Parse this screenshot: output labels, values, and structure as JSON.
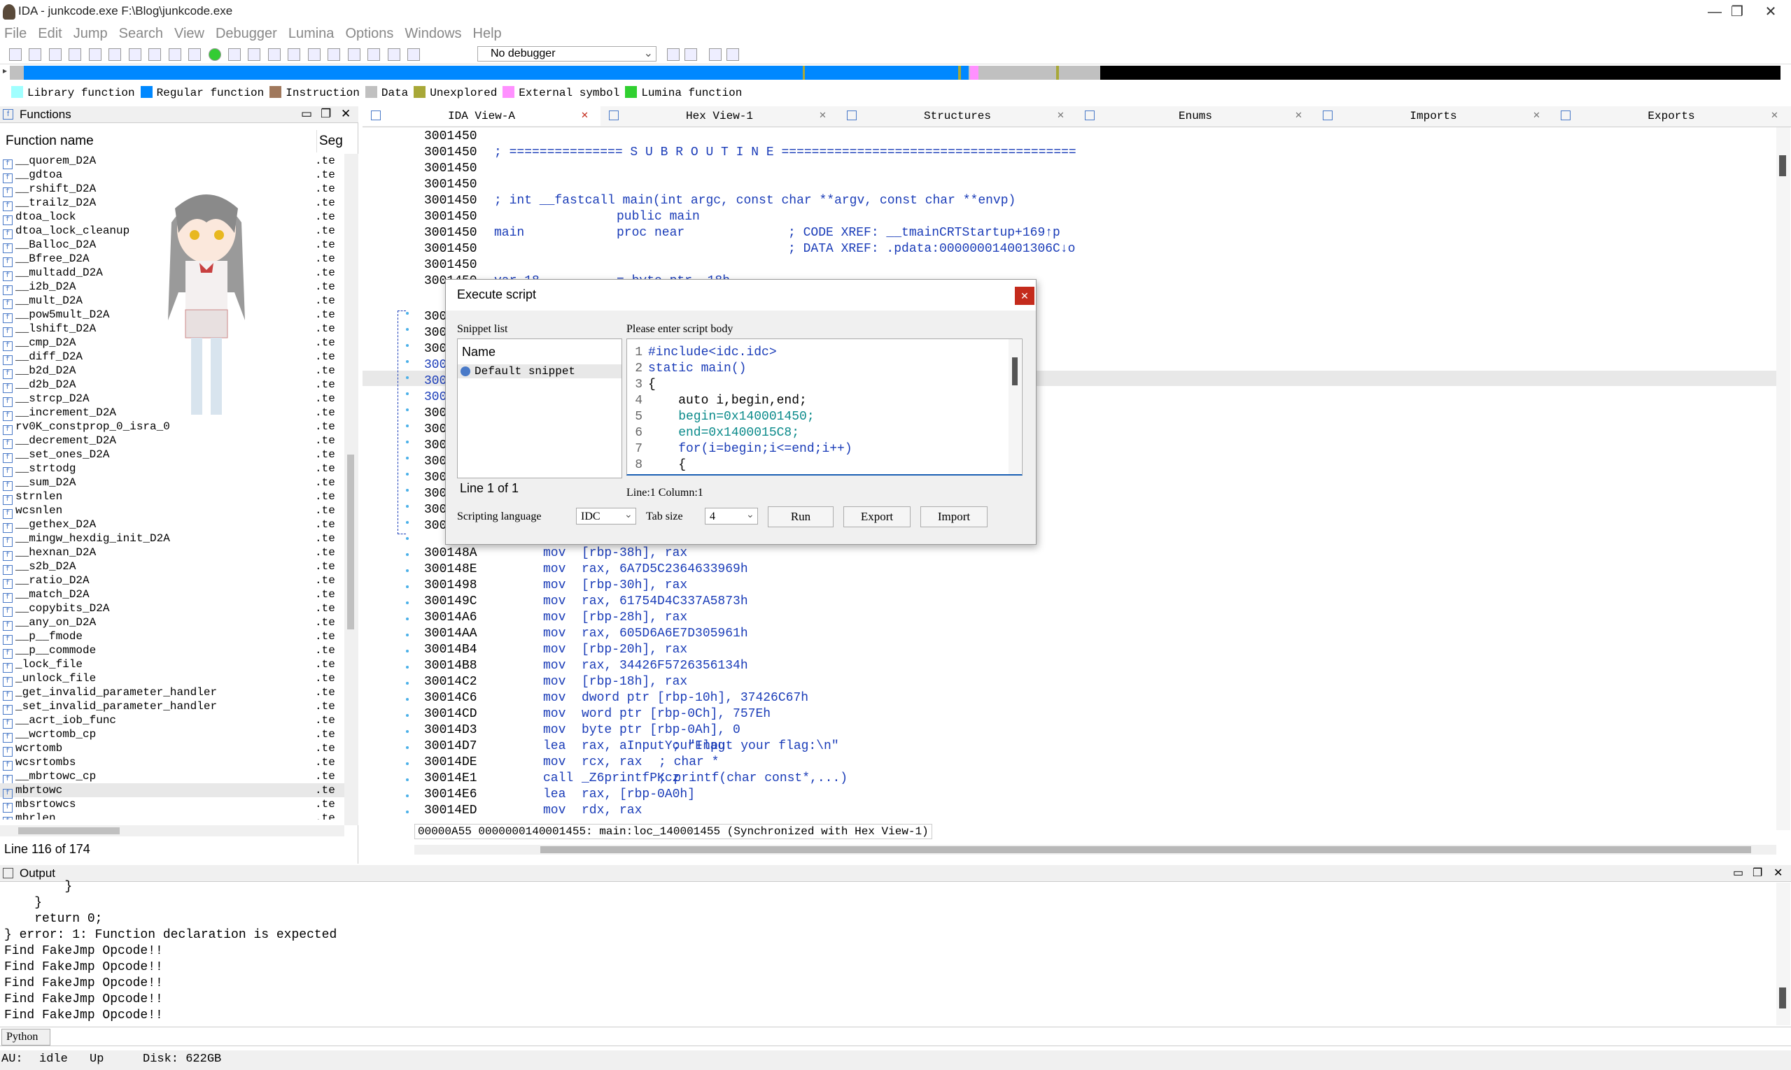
{
  "window": {
    "title": "IDA - junkcode.exe F:\\Blog\\junkcode.exe",
    "min": "—",
    "max": "❐",
    "close": "✕"
  },
  "menu": [
    "File",
    "Edit",
    "Jump",
    "Search",
    "View",
    "Debugger",
    "Lumina",
    "Options",
    "Windows",
    "Help"
  ],
  "toolbar": {
    "debugger": "No debugger"
  },
  "legend": [
    {
      "label": "Library function",
      "color": "#a0ffff"
    },
    {
      "label": "Regular function",
      "color": "#0088ff"
    },
    {
      "label": "Instruction",
      "color": "#a0785c"
    },
    {
      "label": "Data",
      "color": "#c0c0c0"
    },
    {
      "label": "Unexplored",
      "color": "#a8a838"
    },
    {
      "label": "External symbol",
      "color": "#ff90ff"
    },
    {
      "label": "Lumina function",
      "color": "#30d030"
    }
  ],
  "functions": {
    "title": "Functions",
    "col_name": "Function name",
    "col_seg": "Seg",
    "status": "Line 116 of 174",
    "items": [
      "__quorem_D2A",
      "__gdtoa",
      "__rshift_D2A",
      "__trailz_D2A",
      "dtoa_lock",
      "dtoa_lock_cleanup",
      "__Balloc_D2A",
      "__Bfree_D2A",
      "__multadd_D2A",
      "__i2b_D2A",
      "__mult_D2A",
      "__pow5mult_D2A",
      "__lshift_D2A",
      "__cmp_D2A",
      "__diff_D2A",
      "__b2d_D2A",
      "__d2b_D2A",
      "__strcp_D2A",
      "__increment_D2A",
      "rv0K_constprop_0_isra_0",
      "__decrement_D2A",
      "__set_ones_D2A",
      "__strtodg",
      "__sum_D2A",
      "strnlen",
      "wcsnlen",
      "__gethex_D2A",
      "__mingw_hexdig_init_D2A",
      "__hexnan_D2A",
      "__s2b_D2A",
      "__ratio_D2A",
      "__match_D2A",
      "__copybits_D2A",
      "__any_on_D2A",
      "__p__fmode",
      "__p__commode",
      "_lock_file",
      "_unlock_file",
      "_get_invalid_parameter_handler",
      "_set_invalid_parameter_handler",
      "__acrt_iob_func",
      "__wcrtomb_cp",
      "wcrtomb",
      "wcsrtombs",
      "__mbrtowc_cp",
      "mbrtowc",
      "mbsrtowcs",
      "mbrlen"
    ],
    "segs": [
      ".te",
      ".te",
      ".te",
      ".te",
      ".te",
      ".te",
      ".te",
      ".te",
      ".te",
      ".te",
      ".te",
      ".te",
      ".te",
      ".te",
      ".te",
      ".te",
      ".te",
      ".te",
      ".te",
      ".te",
      ".te",
      ".te",
      ".te",
      ".te",
      ".te",
      ".te",
      ".te",
      ".te",
      ".te",
      ".te",
      ".te",
      ".te",
      ".te",
      ".te",
      ".te",
      ".te",
      ".te",
      ".te",
      ".te",
      ".te",
      ".te",
      ".te",
      ".te",
      ".te",
      ".te",
      ".te",
      ".te",
      ".te"
    ]
  },
  "tabs": [
    "IDA View-A",
    "Hex View-1",
    "Structures",
    "Enums",
    "Imports",
    "Exports"
  ],
  "asm_top": [
    {
      "addr": "3001450",
      "c2": "",
      "mn": "",
      "op": "",
      "cm": ""
    },
    {
      "addr": "3001450",
      "c2": "; =============== S U B R O U T I N E =======================================",
      "mn": "",
      "op": "",
      "cm": ""
    },
    {
      "addr": "3001450",
      "c2": "",
      "mn": "",
      "op": "",
      "cm": ""
    },
    {
      "addr": "3001450",
      "c2": "",
      "mn": "",
      "op": "",
      "cm": ""
    },
    {
      "addr": "3001450",
      "c2": "; int __fastcall main(int argc, const char **argv, const char **envp)",
      "mn": "",
      "op": "",
      "cm": ""
    },
    {
      "addr": "3001450",
      "c2": "",
      "mn": "public main",
      "op": "",
      "cm": ""
    },
    {
      "addr": "3001450",
      "c2": "main",
      "mn": "proc near",
      "op": "",
      "cm": "; CODE XREF: __tmainCRTStartup+169↑p"
    },
    {
      "addr": "3001450",
      "c2": "",
      "mn": "",
      "op": "",
      "cm": "; DATA XREF: .pdata:000000014001306C↓o"
    },
    {
      "addr": "3001450",
      "c2": "",
      "mn": "",
      "op": "",
      "cm": ""
    },
    {
      "addr": "3001450",
      "c2": "var_18",
      "mn": "= byte ptr -18h",
      "op": "",
      "cm": ""
    }
  ],
  "asm_hidden": [
    "300",
    "300",
    "300",
    "300",
    "300",
    "300",
    "300",
    "300",
    "300",
    "300",
    "300",
    "300",
    "300",
    "300"
  ],
  "asm_bottom": [
    {
      "addr": "300148A",
      "mn": "mov",
      "op": "[rbp-38h], rax",
      "cm": ""
    },
    {
      "addr": "300148E",
      "mn": "mov",
      "op": "rax, 6A7D5C2364633969h",
      "cm": ""
    },
    {
      "addr": "3001498",
      "mn": "mov",
      "op": "[rbp-30h], rax",
      "cm": ""
    },
    {
      "addr": "300149C",
      "mn": "mov",
      "op": "rax, 61754D4C337A5873h",
      "cm": ""
    },
    {
      "addr": "30014A6",
      "mn": "mov",
      "op": "[rbp-28h], rax",
      "cm": ""
    },
    {
      "addr": "30014AA",
      "mn": "mov",
      "op": "rax, 605D6A6E7D305961h",
      "cm": ""
    },
    {
      "addr": "30014B4",
      "mn": "mov",
      "op": "[rbp-20h], rax",
      "cm": ""
    },
    {
      "addr": "30014B8",
      "mn": "mov",
      "op": "rax, 34426F5726356134h",
      "cm": ""
    },
    {
      "addr": "30014C2",
      "mn": "mov",
      "op": "[rbp-18h], rax",
      "cm": ""
    },
    {
      "addr": "30014C6",
      "mn": "mov",
      "op": "dword ptr [rbp-10h], 37426C67h",
      "cm": ""
    },
    {
      "addr": "30014CD",
      "mn": "mov",
      "op": "word ptr [rbp-0Ch], 757Eh",
      "cm": ""
    },
    {
      "addr": "30014D3",
      "mn": "mov",
      "op": "byte ptr [rbp-0Ah], 0",
      "cm": ""
    },
    {
      "addr": "30014D7",
      "mn": "lea",
      "op": "rax, aInputYourFlag",
      "cm": "; \"Input your flag:\\n\""
    },
    {
      "addr": "30014DE",
      "mn": "mov",
      "op": "rcx, rax",
      "cm": "; char *"
    },
    {
      "addr": "30014E1",
      "mn": "call",
      "op": "_Z6printfPKcz",
      "cm": "; printf(char const*,...)"
    },
    {
      "addr": "30014E6",
      "mn": "lea",
      "op": "rax, [rbp-0A0h]",
      "cm": ""
    },
    {
      "addr": "30014ED",
      "mn": "mov",
      "op": "rdx, rax",
      "cm": ""
    }
  ],
  "ida_status": "00000A55 0000000140001455: main:loc_140001455 (Synchronized with Hex View-1)",
  "dialog": {
    "title": "Execute script",
    "close": "✕",
    "snippet_label": "Snippet list",
    "body_label": "Please enter script body",
    "name_header": "Name",
    "snippet": "Default snippet",
    "line_status": "Line 1 of 1",
    "cursor": "Line:1   Column:1",
    "lang_label": "Scripting language",
    "lang": "IDC",
    "tab_label": "Tab size",
    "tab": "4",
    "run": "Run",
    "export": "Export",
    "import": "Import",
    "code": [
      "#include<idc.idc>",
      "static main()",
      "{",
      "    auto i,begin,end;",
      "    begin=0x140001450;",
      "    end=0x1400015C8;",
      "    for(i=begin;i<=end;i++)",
      "    {"
    ]
  },
  "output": {
    "title": "Output",
    "lines": [
      "        }",
      "    }",
      "    return 0;",
      "} error: 1: Function declaration is expected",
      "Find FakeJmp Opcode!!",
      "Find FakeJmp Opcode!!",
      "Find FakeJmp Opcode!!",
      "Find FakeJmp Opcode!!",
      "Find FakeJmp Opcode!!"
    ],
    "python": "Python"
  },
  "status": {
    "au": "AU:",
    "state": "idle",
    "dir": "Up",
    "disk": "Disk: 622GB"
  }
}
